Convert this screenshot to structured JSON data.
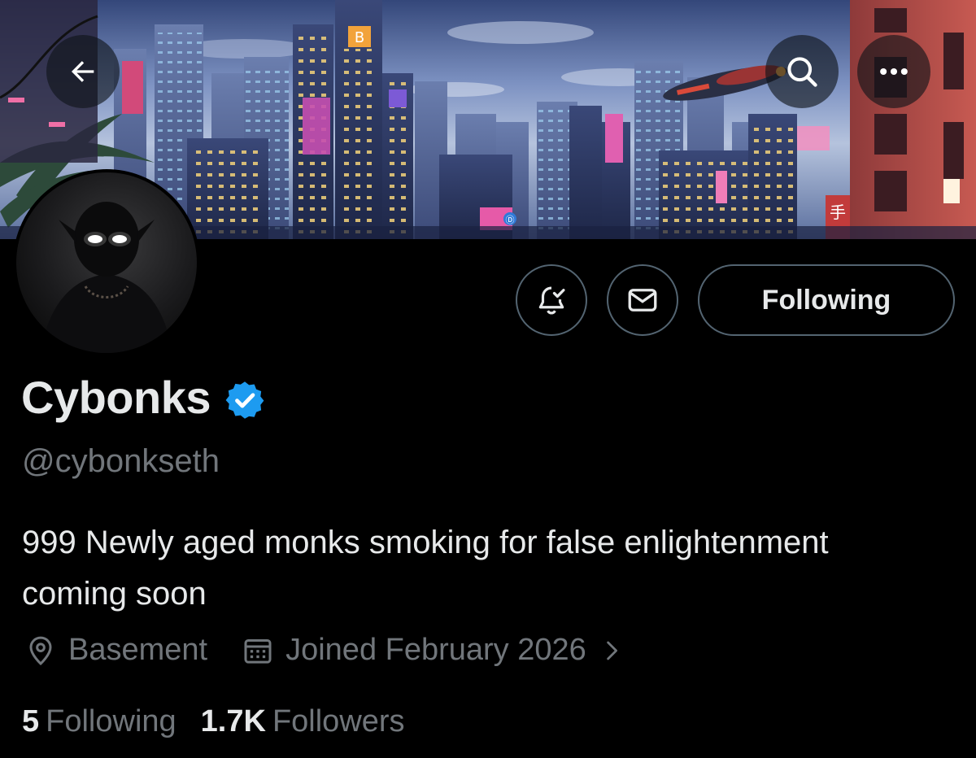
{
  "profile": {
    "display_name": "Cybonks",
    "handle": "@cybonkseth",
    "bio": "999 Newly aged monks smoking for false enlightenment coming soon",
    "location": "Basement",
    "joined": "Joined February 2026",
    "verified": true
  },
  "banner": {
    "sign_text_1": "B",
    "sign_text_2": "手",
    "sign_text_3": "Ⓓ"
  },
  "actions": {
    "follow_label": "Following"
  },
  "stats": {
    "following_count": "5",
    "following_label": "Following",
    "followers_count": "1.7K",
    "followers_label": "Followers"
  },
  "icons": {
    "back": "arrow-left-icon",
    "search": "search-icon",
    "more": "more-horizontal-icon",
    "notify": "bell-check-icon",
    "message": "envelope-icon",
    "location": "location-pin-icon",
    "calendar": "calendar-icon",
    "verified": "verified-badge-icon",
    "chevron": "chevron-right-icon"
  },
  "colors": {
    "background": "#000000",
    "text_primary": "#e7e9ea",
    "text_secondary": "#71767b",
    "border": "#536471",
    "verified_blue": "#1d9bf0"
  }
}
